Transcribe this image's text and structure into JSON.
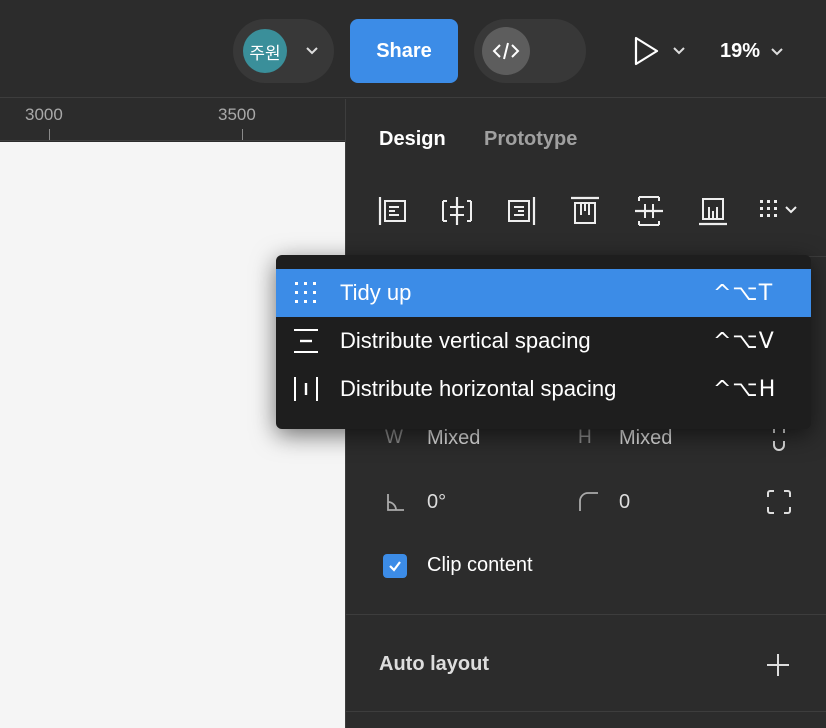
{
  "toolbar": {
    "avatar_initials": "주원",
    "share_label": "Share",
    "zoom_label": "19%"
  },
  "ruler": {
    "labels": [
      "3000",
      "3500"
    ]
  },
  "panel": {
    "tabs": [
      {
        "label": "Design",
        "active": true
      },
      {
        "label": "Prototype",
        "active": false
      }
    ],
    "align_icons": [
      "align-left-icon",
      "align-horizontal-center-icon",
      "align-right-icon",
      "align-top-icon",
      "align-vertical-center-icon",
      "align-bottom-icon",
      "tidy-up-menu-icon"
    ],
    "width_label": "W",
    "width_value": "Mixed",
    "height_label": "H",
    "height_value": "Mixed",
    "rotation_value": "0°",
    "radius_value": "0",
    "clip_content": {
      "label": "Clip content",
      "checked": true
    },
    "auto_layout_label": "Auto layout"
  },
  "menu": {
    "items": [
      {
        "label": "Tidy up",
        "shortcut": "^⌥T",
        "icon": "tidy-up-icon",
        "active": true
      },
      {
        "label": "Distribute vertical spacing",
        "shortcut": "^⌥V",
        "icon": "distribute-vertical-icon",
        "active": false
      },
      {
        "label": "Distribute horizontal spacing",
        "shortcut": "^⌥H",
        "icon": "distribute-horizontal-icon",
        "active": false
      }
    ]
  },
  "colors": {
    "accent": "#3c8ce7",
    "panel_bg": "#2c2c2c",
    "menu_bg": "#1e1e1e",
    "canvas_bg": "#f5f5f5",
    "avatar_bg": "#3a8f9a"
  }
}
